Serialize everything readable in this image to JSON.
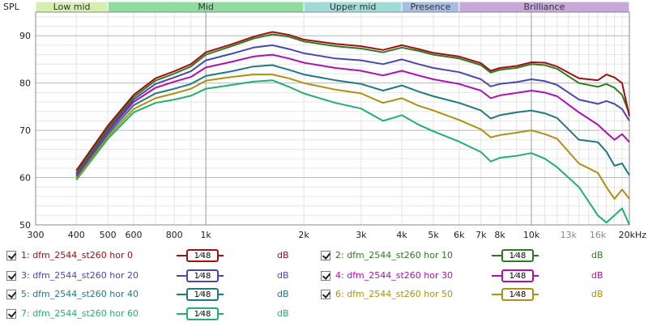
{
  "chart_data": {
    "type": "line",
    "ylabel": "SPL",
    "x_unit_label": "Hz",
    "x_scale": "log",
    "xlim": [
      300,
      20000
    ],
    "ylim": [
      50,
      95
    ],
    "x_ticks": [
      {
        "value": 300,
        "label": "300"
      },
      {
        "value": 400,
        "label": "400"
      },
      {
        "value": 500,
        "label": "500"
      },
      {
        "value": 600,
        "label": "600"
      },
      {
        "value": 800,
        "label": "800"
      },
      {
        "value": 1000,
        "label": "1k"
      },
      {
        "value": 2000,
        "label": "2k"
      },
      {
        "value": 3000,
        "label": "3k"
      },
      {
        "value": 4000,
        "label": "4k"
      },
      {
        "value": 5000,
        "label": "5k"
      },
      {
        "value": 6000,
        "label": "6k"
      },
      {
        "value": 7000,
        "label": "7k"
      },
      {
        "value": 8000,
        "label": "8k"
      },
      {
        "value": 10000,
        "label": "10k"
      },
      {
        "value": 13000,
        "label": "13k"
      },
      {
        "value": 16000,
        "label": "16k"
      },
      {
        "value": 20000,
        "label": "20kHz"
      }
    ],
    "y_ticks": [
      {
        "value": 50,
        "label": "50"
      },
      {
        "value": 60,
        "label": "60"
      },
      {
        "value": 70,
        "label": "70"
      },
      {
        "value": 80,
        "label": "80"
      },
      {
        "value": 90,
        "label": "90"
      }
    ],
    "bands": [
      {
        "name": "Low mid",
        "from": 300,
        "to": 500,
        "color": "#d6eeb0"
      },
      {
        "name": "Mid",
        "from": 500,
        "to": 2000,
        "color": "#8fdca0"
      },
      {
        "name": "Upper mid",
        "from": 2000,
        "to": 4000,
        "color": "#9fdcd8"
      },
      {
        "name": "Presence",
        "from": 4000,
        "to": 6000,
        "color": "#a8bde6"
      },
      {
        "name": "Brilliance",
        "from": 6000,
        "to": 20000,
        "color": "#c8a8da"
      }
    ],
    "x": [
      400,
      500,
      600,
      700,
      800,
      900,
      1000,
      1200,
      1400,
      1600,
      1800,
      2000,
      2500,
      3000,
      3500,
      4000,
      4500,
      5000,
      6000,
      7000,
      7500,
      8000,
      9000,
      10000,
      11000,
      12000,
      14000,
      16000,
      17000,
      18000,
      19000,
      20000
    ],
    "series": [
      {
        "name": "1: dfm_2544_st260 hor 0",
        "color": "#a01010",
        "values": [
          61.5,
          71,
          77.5,
          81,
          82.5,
          84,
          86.5,
          88.2,
          89.8,
          90.8,
          90.2,
          89.2,
          88.3,
          87.8,
          87.0,
          88.0,
          87.2,
          86.4,
          85.6,
          84.2,
          82.6,
          83.2,
          83.6,
          84.4,
          84.3,
          83.5,
          81.0,
          80.6,
          81.8,
          81.2,
          80.0,
          73.0
        ]
      },
      {
        "name": "2: dfm_2544_st260 hor 10",
        "color": "#2e7a1e",
        "values": [
          61.0,
          70.5,
          77.0,
          80.5,
          82.0,
          83.5,
          86.0,
          87.8,
          89.4,
          90.3,
          89.8,
          88.8,
          87.8,
          87.3,
          86.5,
          87.5,
          86.8,
          86.0,
          85.2,
          83.8,
          82.2,
          82.8,
          83.2,
          84.0,
          83.8,
          83.0,
          80.0,
          79.2,
          79.8,
          79.0,
          77.5,
          73.5
        ]
      },
      {
        "name": "3: dfm_2544_st260 hor 20",
        "color": "#4848b0",
        "values": [
          60.8,
          70.0,
          76.5,
          79.8,
          81.2,
          82.5,
          84.8,
          86.2,
          87.5,
          88.0,
          87.2,
          86.3,
          85.2,
          84.8,
          84.0,
          85.0,
          84.0,
          83.2,
          82.3,
          80.8,
          79.3,
          79.8,
          80.2,
          80.8,
          80.4,
          79.6,
          76.5,
          75.6,
          76.2,
          75.6,
          74.5,
          72.0
        ]
      },
      {
        "name": "4: dfm_2544_st260 hor 30",
        "color": "#b010b0",
        "values": [
          60.5,
          69.7,
          76.0,
          79.0,
          80.3,
          81.3,
          83.3,
          84.5,
          85.6,
          86.0,
          85.2,
          84.3,
          83.2,
          82.6,
          81.6,
          82.6,
          81.6,
          80.8,
          79.8,
          78.4,
          76.8,
          77.4,
          77.9,
          78.4,
          78.0,
          77.2,
          73.8,
          71.2,
          69.5,
          68.0,
          69.2,
          67.5
        ]
      },
      {
        "name": "5: dfm_2544_st260 hor 40",
        "color": "#1f7a80",
        "values": [
          60.2,
          69.2,
          75.3,
          77.8,
          78.8,
          79.8,
          81.5,
          82.5,
          83.5,
          83.8,
          82.8,
          81.8,
          80.6,
          79.8,
          78.4,
          79.5,
          78.2,
          77.2,
          75.8,
          74.2,
          72.5,
          73.2,
          73.8,
          74.2,
          73.6,
          72.6,
          68.0,
          67.5,
          65.5,
          62.5,
          63.0,
          60.5
        ]
      },
      {
        "name": "6: dfm_2544_st260 hor 50",
        "color": "#b09010",
        "values": [
          59.8,
          68.7,
          74.5,
          76.8,
          77.8,
          78.8,
          80.5,
          81.3,
          81.8,
          81.8,
          81.0,
          80.0,
          78.6,
          77.8,
          75.8,
          76.8,
          75.2,
          74.2,
          72.2,
          70.2,
          68.5,
          69.0,
          69.5,
          70.0,
          69.2,
          68.2,
          63.0,
          61.0,
          58.0,
          55.5,
          57.5,
          55.5
        ]
      },
      {
        "name": "7: dfm_2544_st260 hor 60",
        "color": "#20b070",
        "values": [
          59.5,
          68.2,
          73.8,
          75.8,
          76.5,
          77.3,
          78.8,
          79.6,
          80.3,
          80.6,
          79.2,
          77.8,
          75.8,
          74.6,
          72.0,
          73.2,
          71.2,
          69.8,
          67.6,
          65.4,
          63.4,
          64.2,
          64.6,
          65.2,
          64.0,
          62.2,
          58.0,
          52.0,
          50.5,
          52.0,
          53.5,
          50.0
        ]
      }
    ]
  },
  "legend": {
    "smooth_label": "1⁄48",
    "unit": "dB",
    "entries": [
      {
        "name": "1: dfm_2544_st260 hor 0",
        "color": "#a01010",
        "checked": true
      },
      {
        "name": "2: dfm_2544_st260 hor 10",
        "color": "#2e7a1e",
        "checked": true
      },
      {
        "name": "3: dfm_2544_st260 hor 20",
        "color": "#4848b0",
        "checked": true
      },
      {
        "name": "4: dfm_2544_st260 hor 30",
        "color": "#b010b0",
        "checked": true
      },
      {
        "name": "5: dfm_2544_st260 hor 40",
        "color": "#1f7a80",
        "checked": true
      },
      {
        "name": "6: dfm_2544_st260 hor 50",
        "color": "#b09010",
        "checked": true
      },
      {
        "name": "7: dfm_2544_st260 hor 60",
        "color": "#20b070",
        "checked": true
      }
    ]
  }
}
